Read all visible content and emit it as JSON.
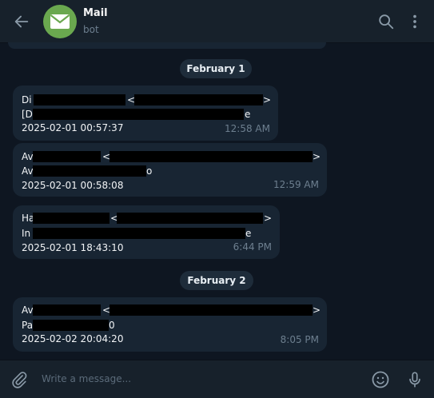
{
  "header": {
    "title": "Mail",
    "subtitle": "bot",
    "icons": [
      "back-arrow-icon",
      "envelope-icon",
      "search-icon",
      "more-vertical-icon"
    ]
  },
  "dates": [
    "February 1",
    "February 2"
  ],
  "messages": [
    {
      "l1a": "Di",
      "l1b": "<",
      "l1c": ">",
      "l2a": "[D",
      "l2b": "e",
      "l3": "2025-02-01 00:57:37",
      "time": "12:58 AM"
    },
    {
      "l1a": "Av",
      "l1b": "<",
      "l1c": ">",
      "l2a": "Av",
      "l2b": "o",
      "l3": "2025-02-01 00:58:08",
      "time": "12:59 AM"
    },
    {
      "l1a": "Ha",
      "l1b": "<",
      "l1c": ">",
      "l2a": "In",
      "l2b": "e",
      "l3": "2025-02-01 18:43:10",
      "time": "6:44 PM"
    },
    {
      "l1a": "Av",
      "l1b": "<",
      "l1c": ">",
      "l2a": "Pa",
      "l2b": "0",
      "l3": "2025-02-02 20:04:20",
      "time": "8:05 PM"
    }
  ],
  "composer": {
    "placeholder": "Write a message...",
    "icons": [
      "paperclip-icon",
      "emoji-icon",
      "microphone-icon"
    ]
  },
  "colors": {
    "background": "#0e1621",
    "panel": "#17212b",
    "bubble": "#182533",
    "avatar": "#6aa84f",
    "muted": "#6d7f8f"
  }
}
